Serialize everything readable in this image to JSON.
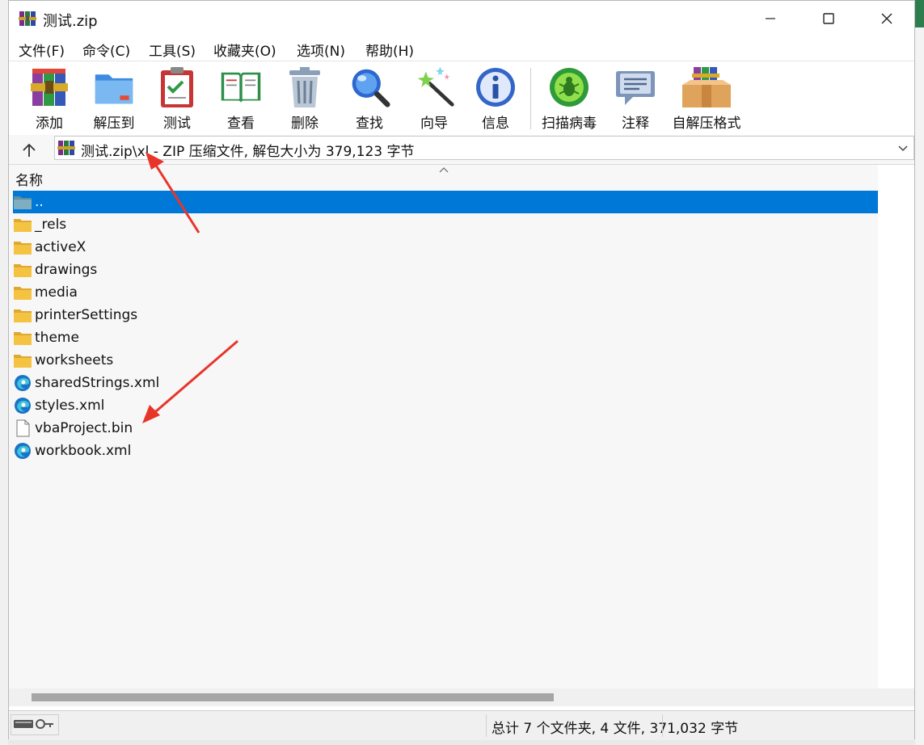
{
  "window": {
    "title": "测试.zip"
  },
  "menu": [
    "文件(F)",
    "命令(C)",
    "工具(S)",
    "收藏夹(O)",
    "选项(N)",
    "帮助(H)"
  ],
  "toolbar": [
    {
      "label": "添加",
      "icon": "add-archive-icon"
    },
    {
      "label": "解压到",
      "icon": "extract-folder-icon"
    },
    {
      "label": "测试",
      "icon": "test-clipboard-icon"
    },
    {
      "label": "查看",
      "icon": "view-book-icon"
    },
    {
      "label": "删除",
      "icon": "trash-icon"
    },
    {
      "label": "查找",
      "icon": "magnifier-icon"
    },
    {
      "label": "向导",
      "icon": "wizard-wand-icon"
    },
    {
      "label": "信息",
      "icon": "info-icon"
    },
    {
      "label": "扫描病毒",
      "icon": "virus-scan-icon"
    },
    {
      "label": "注释",
      "icon": "comment-icon"
    },
    {
      "label": "自解压格式",
      "icon": "sfx-box-icon"
    }
  ],
  "address": {
    "path": "测试.zip\\xl",
    "detail": " - ZIP 压缩文件, 解包大小为 379,123 字节"
  },
  "list": {
    "column_name": "名称",
    "items": [
      {
        "name": "..",
        "type": "parent",
        "selected": true
      },
      {
        "name": "_rels",
        "type": "folder"
      },
      {
        "name": "activeX",
        "type": "folder"
      },
      {
        "name": "drawings",
        "type": "folder"
      },
      {
        "name": "media",
        "type": "folder"
      },
      {
        "name": "printerSettings",
        "type": "folder"
      },
      {
        "name": "theme",
        "type": "folder"
      },
      {
        "name": "worksheets",
        "type": "folder"
      },
      {
        "name": "sharedStrings.xml",
        "type": "xml"
      },
      {
        "name": "styles.xml",
        "type": "xml"
      },
      {
        "name": "vbaProject.bin",
        "type": "file"
      },
      {
        "name": "workbook.xml",
        "type": "xml"
      }
    ]
  },
  "status": {
    "summary": "总计 7 个文件夹, 4 文件, 371,032 字节"
  },
  "colors": {
    "selection": "#0078d7",
    "annotation_arrow": "#e8352a",
    "folder": "#f5c342"
  }
}
